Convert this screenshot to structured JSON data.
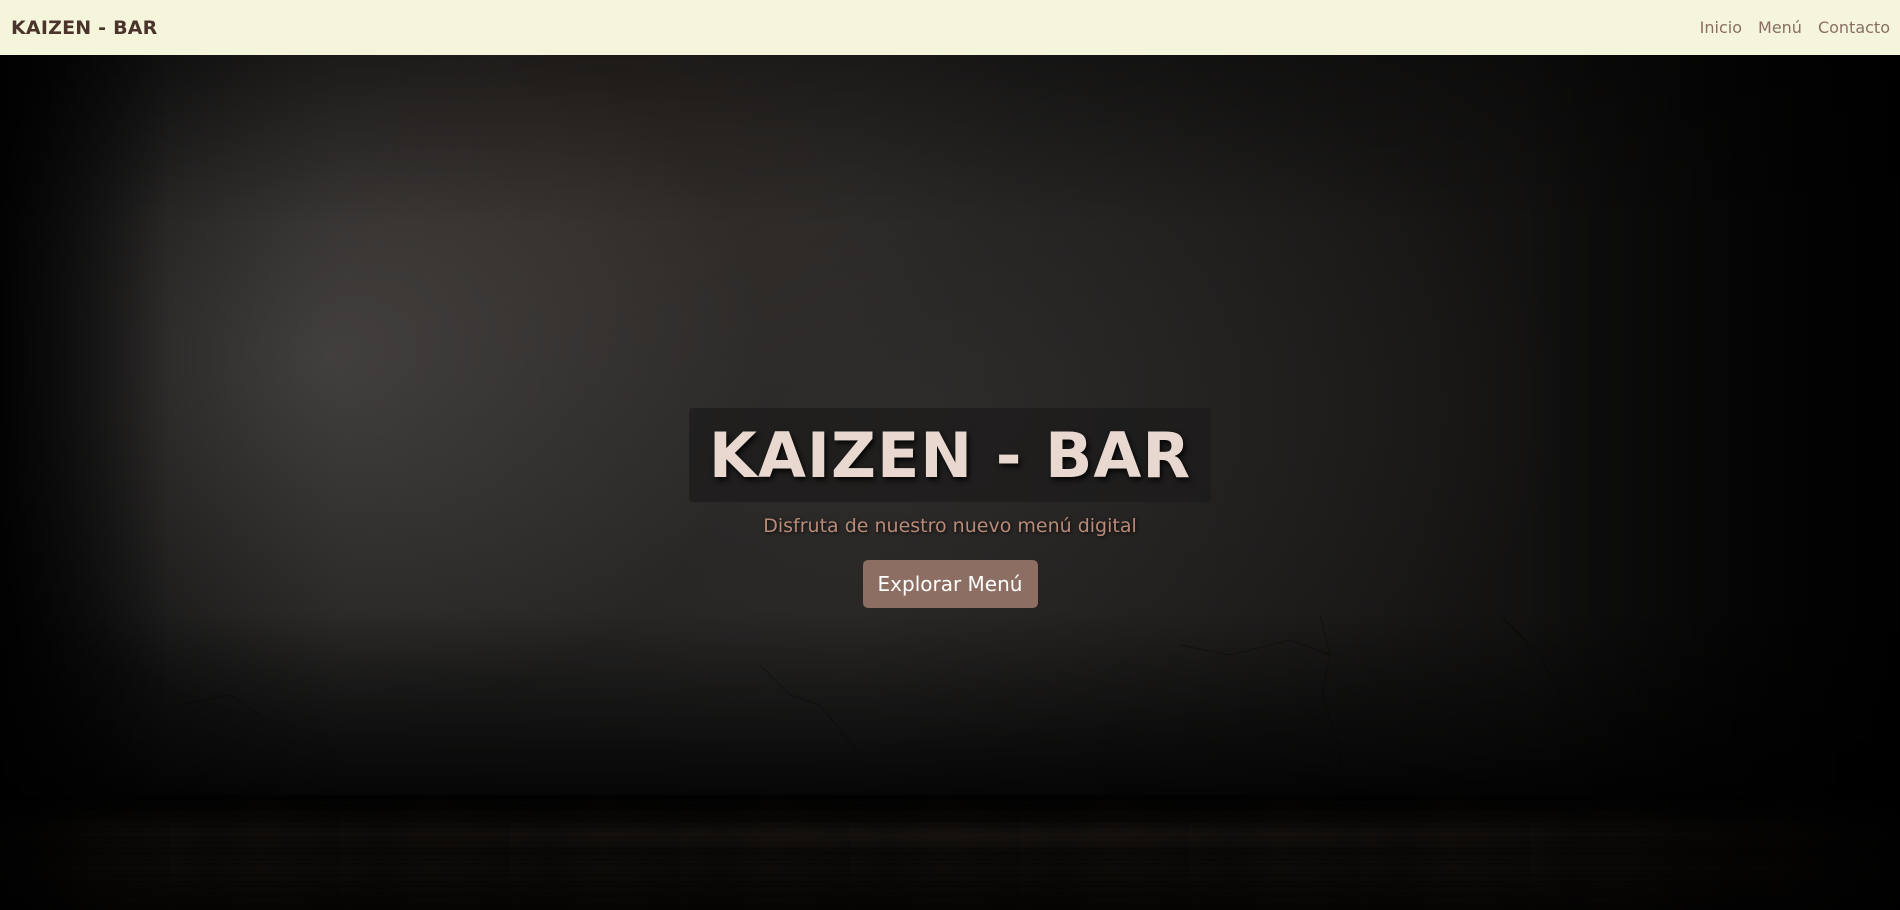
{
  "navbar": {
    "brand": "KAIZEN - BAR",
    "links": [
      {
        "label": "Inicio"
      },
      {
        "label": "Menú"
      },
      {
        "label": "Contacto"
      }
    ],
    "background_color": "#f5f5dc"
  },
  "hero": {
    "title": "KAIZEN - BAR",
    "subtitle": "Disfruta de nuestro nuevo menú digital",
    "cta_label": "Explorar Menú",
    "button_color": "#8d6e63",
    "title_color": "#e8d8d0",
    "subtitle_color": "#b88a78"
  }
}
